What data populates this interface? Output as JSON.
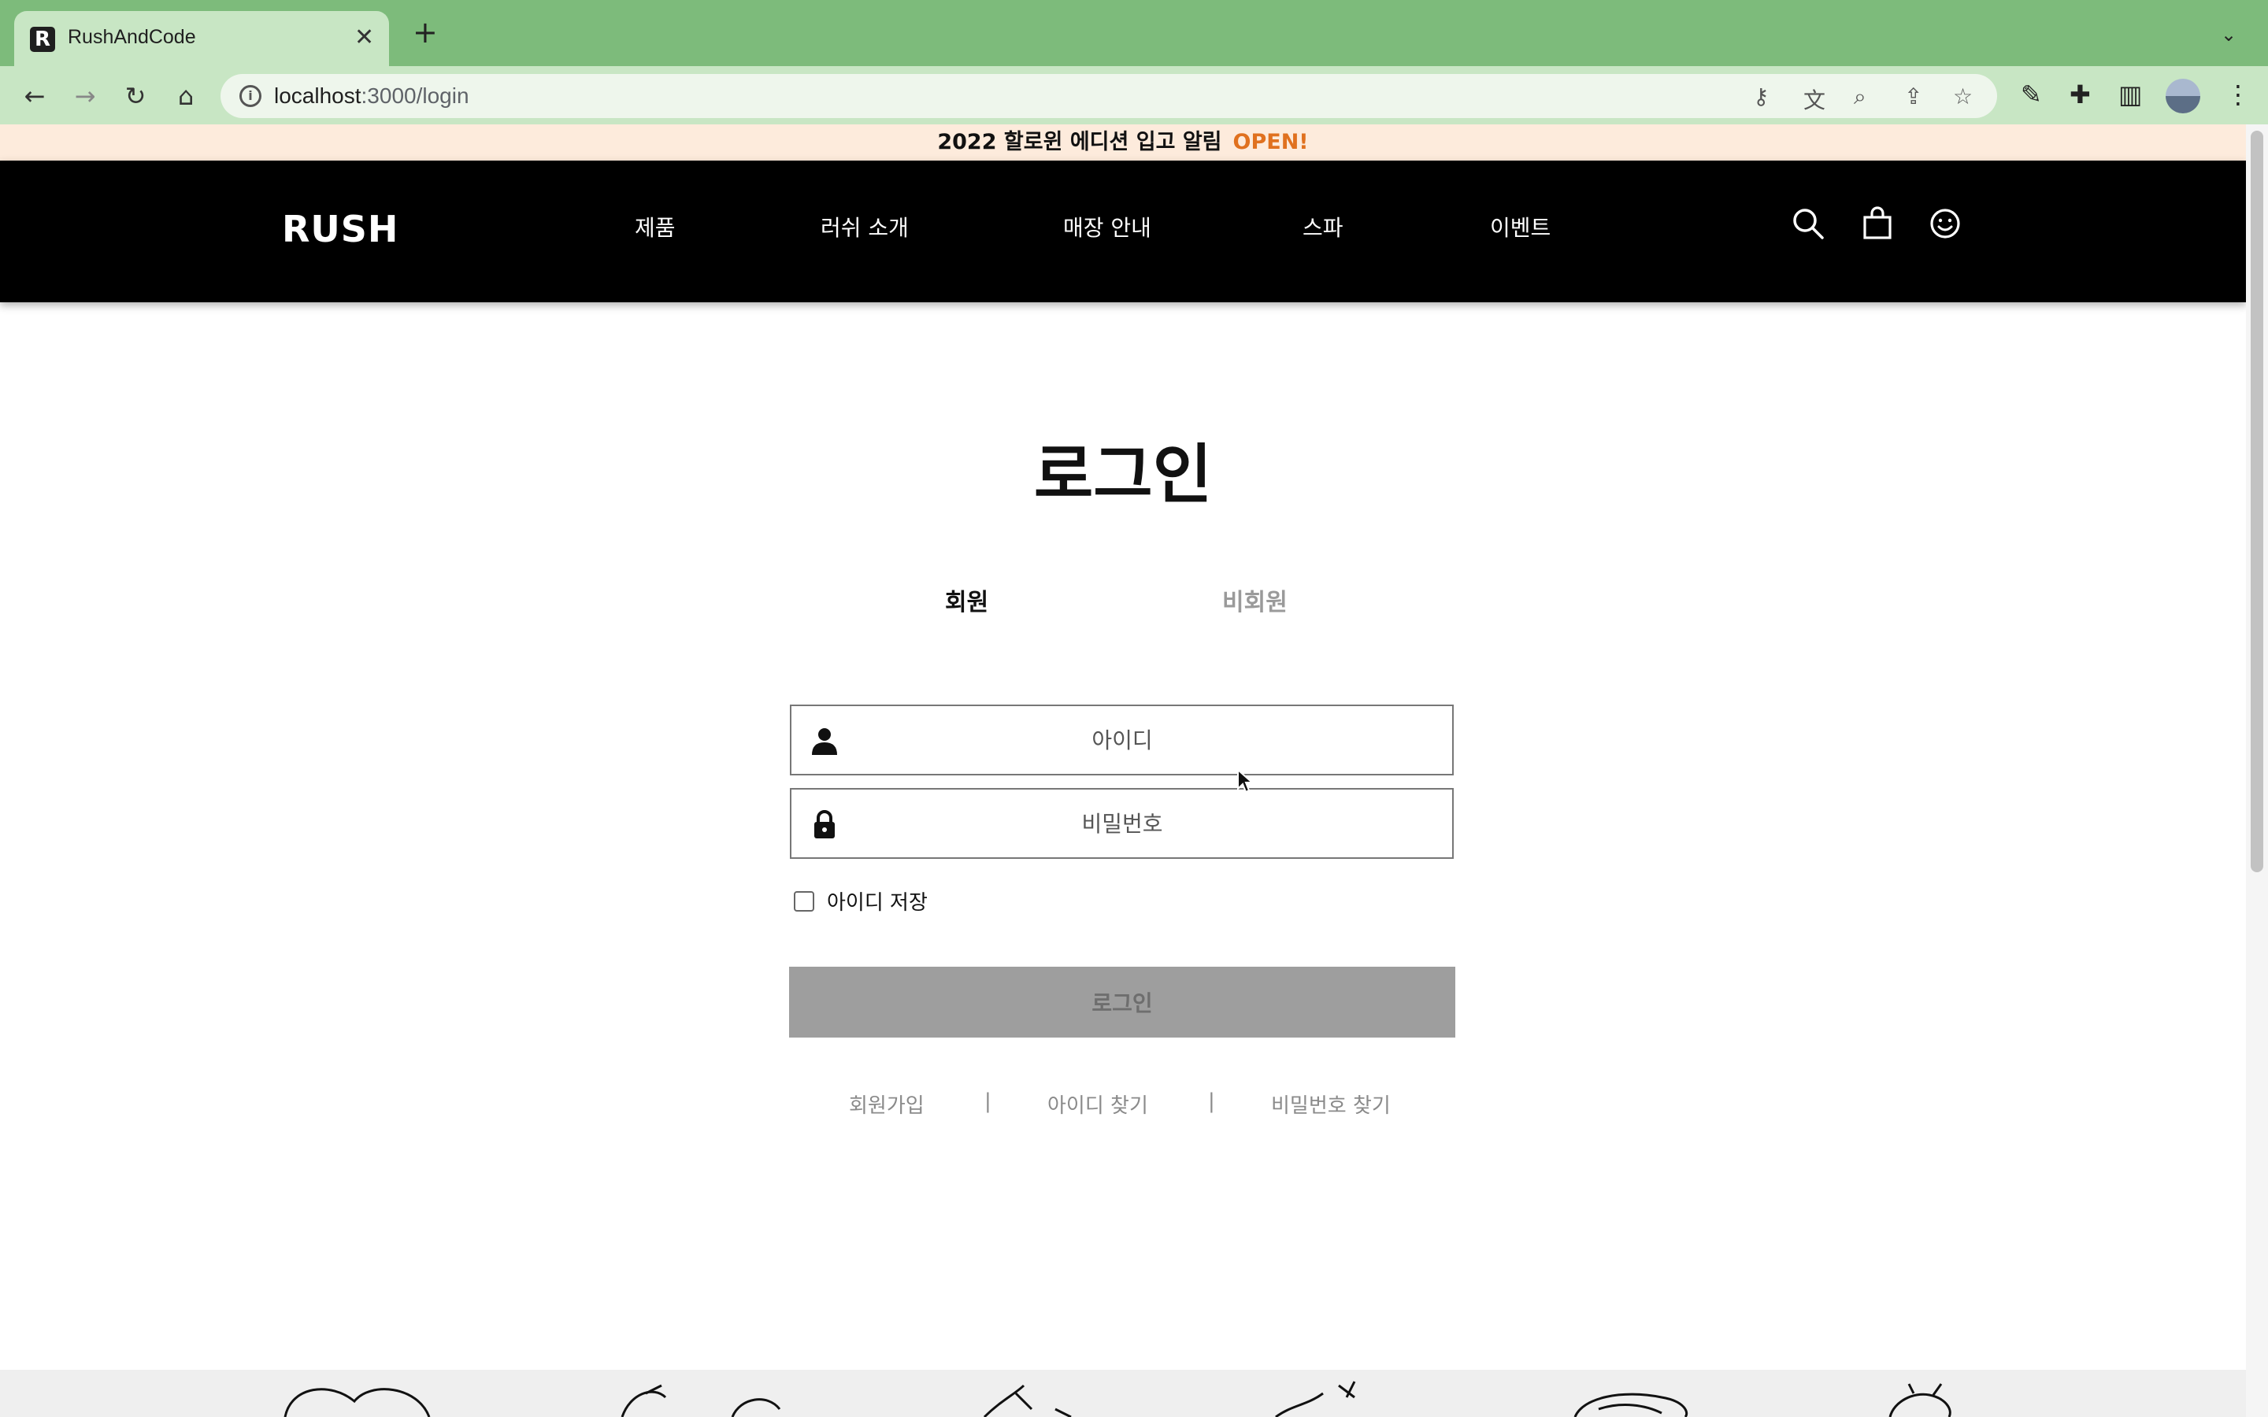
{
  "browser": {
    "tab_title": "RushAndCode",
    "favicon_letter": "R",
    "url_host": "localhost",
    "url_path": ":3000/login"
  },
  "notice": {
    "text": "2022 할로윈 에디션 입고 알림",
    "badge": "OPEN!"
  },
  "header": {
    "logo": "RUSH",
    "menu": [
      "제품",
      "러쉬 소개",
      "매장 안내",
      "스파",
      "이벤트"
    ]
  },
  "login": {
    "title": "로그인",
    "tabs": [
      "회원",
      "비회원"
    ],
    "id_placeholder": "아이디",
    "password_placeholder": "비밀번호",
    "remember_label": "아이디 저장",
    "submit_label": "로그인",
    "links": [
      "회원가입",
      "아이디 찾기",
      "비밀번호 찾기"
    ],
    "separator": "|"
  },
  "colors": {
    "chrome_green": "#7dbb7b",
    "notice_bg": "#fdebdc",
    "open_accent": "#e0711f",
    "header_bg": "#000000",
    "button_disabled": "#9e9e9e"
  }
}
